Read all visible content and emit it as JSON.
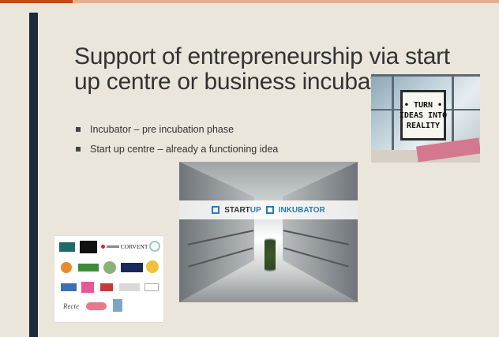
{
  "slide": {
    "title": "Support of entrepreneurship via start up centre or business incubators.",
    "bullets": [
      "Incubator – pre incubation phase",
      "Start up centre – already a functioning idea"
    ]
  },
  "lightbox_photo": {
    "lines": [
      "• TURN •",
      "IDEAS INTO",
      "REALITY"
    ]
  },
  "atrium_photo": {
    "banner_left_a": "START",
    "banner_left_b": "UP",
    "banner_right": "INKUBATOR"
  },
  "partners": {
    "logos": [
      "CORVENT",
      "Recte"
    ]
  },
  "colors": {
    "background": "#ebe6dc",
    "accent_bar": "#1d2a3c",
    "top_strip": "#c24a1b",
    "brand_blue": "#2b7bbd"
  }
}
